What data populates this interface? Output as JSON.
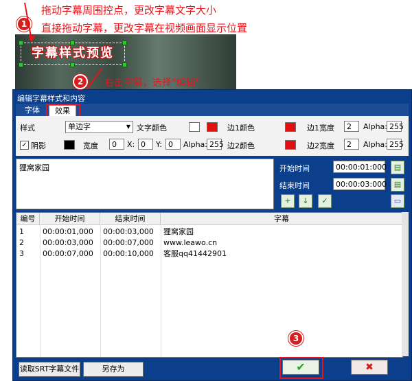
{
  "annotations": {
    "line1": "拖动字幕周围控点，更改字幕文字大小",
    "line2": "直接拖动字幕，更改字幕在视频画面显示位置",
    "note2": "右击字幕，选择\"编辑\"",
    "badge1": "1",
    "badge2": "2",
    "badge3": "3"
  },
  "preview": {
    "text": "字幕样式预览"
  },
  "dialog": {
    "title": "编辑字幕样式和内容",
    "tabs": [
      {
        "label": "字体"
      },
      {
        "label": "效果"
      }
    ],
    "effects": {
      "style_label": "样式",
      "style_value": "单边字",
      "text_color_label": "文字颜色",
      "edge1_color_label": "边1颜色",
      "edge1_width_label": "边1宽度",
      "edge1_width": "2",
      "alpha_label": "Alpha:",
      "alpha1": "255",
      "shadow_label": "阴影",
      "width_label": "宽度",
      "width_value": "0",
      "x_label": "X:",
      "x_value": "0",
      "y_label": "Y:",
      "y_value": "0",
      "shadow_alpha": "255",
      "edge2_color_label": "边2颜色",
      "edge2_width_label": "边2宽度",
      "edge2_width": "2",
      "alpha2": "255",
      "colors": {
        "text": "#ffffff",
        "text2": "#e01010",
        "edge1": "#e01010",
        "shadow": "#000000",
        "edge2": "#e01010"
      }
    },
    "subtitle_text": "狸窝家园",
    "start_time_label": "开始时间",
    "start_time": "00:00:01:000",
    "end_time_label": "结束时间",
    "end_time": "00:00:03:000",
    "table": {
      "headers": [
        "编号",
        "开始时间",
        "结束时间",
        "字幕"
      ],
      "rows": [
        [
          "1",
          "00:00:01,000",
          "00:00:03,000",
          "狸窝家园"
        ],
        [
          "2",
          "00:00:03,000",
          "00:00:07,000",
          "www.leawo.cn"
        ],
        [
          "3",
          "00:00:07,000",
          "00:00:10,000",
          "客服qq41442901"
        ]
      ]
    },
    "buttons": {
      "read_srt": "读取SRT字幕文件",
      "save_as": "另存为",
      "ok_symbol": "✔",
      "cancel_symbol": "✖"
    }
  }
}
